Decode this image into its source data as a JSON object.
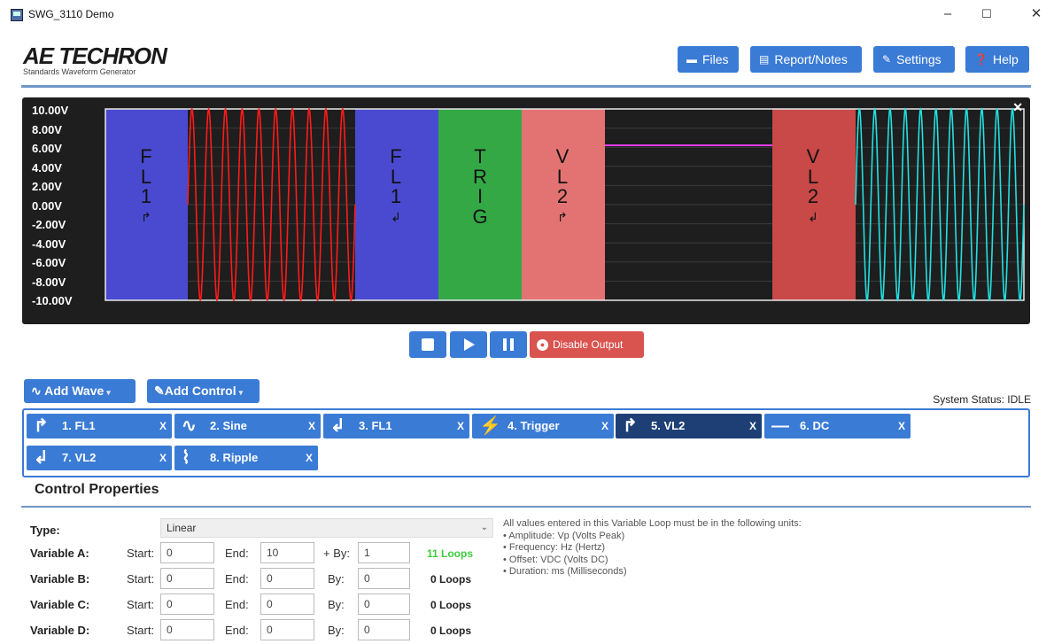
{
  "window": {
    "title": "SWG_3110 Demo",
    "minimize": "–",
    "maximize": "☐",
    "close": "✕"
  },
  "header": {
    "brand": "AE TECHRON",
    "subtitle": "Standards Waveform Generator",
    "buttons": [
      {
        "label": "Files",
        "icon": "folder-icon"
      },
      {
        "label": "Report/Notes",
        "icon": "clipboard-icon"
      },
      {
        "label": "Settings",
        "icon": "wrench-icon"
      },
      {
        "label": "Help",
        "icon": "help-icon"
      }
    ]
  },
  "waveform": {
    "y_labels": [
      "10.00V",
      "8.00V",
      "6.00V",
      "4.00V",
      "2.00V",
      "0.00V",
      "-2.00V",
      "-4.00V",
      "-6.00V",
      "-8.00V",
      "-10.00V"
    ],
    "segments": [
      {
        "label": [
          "F",
          "L",
          "1",
          "↱"
        ],
        "color": "#4a4ad0"
      },
      {
        "label": [
          "F",
          "L",
          "1",
          "↲"
        ],
        "color": "#4a4ad0"
      },
      {
        "label": [
          "T",
          "R",
          "I",
          "G"
        ],
        "color": "#33a845"
      },
      {
        "label": [
          "V",
          "L",
          "2",
          "↱"
        ],
        "color": "#e37373"
      },
      {
        "label": [
          "V",
          "L",
          "2",
          "↲"
        ],
        "color": "#c94848"
      }
    ],
    "colors": {
      "sine": "#ff1a1a",
      "ripple": "#22e0e0",
      "dc": "#e63be6"
    }
  },
  "playback": {
    "disable_output": "Disable Output"
  },
  "add": {
    "wave": "Add Wave",
    "control": "Add Control"
  },
  "status": "System Status: IDLE",
  "steps": [
    {
      "icon": "↱",
      "label": "1. FL1",
      "x": "X"
    },
    {
      "icon": "∿",
      "label": "2. Sine",
      "x": "X"
    },
    {
      "icon": "↲",
      "label": "3. FL1",
      "x": "X"
    },
    {
      "icon": "⚡",
      "label": "4. Trigger",
      "x": "X"
    },
    {
      "icon": "↱",
      "label": "5. VL2",
      "x": "X"
    },
    {
      "icon": "—",
      "label": "6. DC",
      "x": "X"
    },
    {
      "icon": "↲",
      "label": "7. VL2",
      "x": "X"
    },
    {
      "icon": "⌇",
      "label": "8. Ripple",
      "x": "X"
    }
  ],
  "control_properties": {
    "title": "Control Properties",
    "type_label": "Type:",
    "type_value": "Linear",
    "rows": [
      {
        "label": "Variable A:",
        "start_label": "Start:",
        "start": "0",
        "end_label": "End:",
        "end": "10",
        "by_label": "+ By:",
        "by": "1",
        "loops": "11 Loops"
      },
      {
        "label": "Variable B:",
        "start_label": "Start:",
        "start": "0",
        "end_label": "End:",
        "end": "0",
        "by_label": "By:",
        "by": "0",
        "loops": "0 Loops"
      },
      {
        "label": "Variable C:",
        "start_label": "Start:",
        "start": "0",
        "end_label": "End:",
        "end": "0",
        "by_label": "By:",
        "by": "0",
        "loops": "0 Loops"
      },
      {
        "label": "Variable D:",
        "start_label": "Start:",
        "start": "0",
        "end_label": "End:",
        "end": "0",
        "by_label": "By:",
        "by": "0",
        "loops": "0 Loops"
      }
    ],
    "notes": [
      "All values entered in this Variable Loop must be in the following units:",
      "• Amplitude: Vp (Volts Peak)",
      "• Frequency: Hz (Hertz)",
      "• Offset: VDC (Volts DC)",
      "• Duration: ms (Milliseconds)"
    ]
  }
}
